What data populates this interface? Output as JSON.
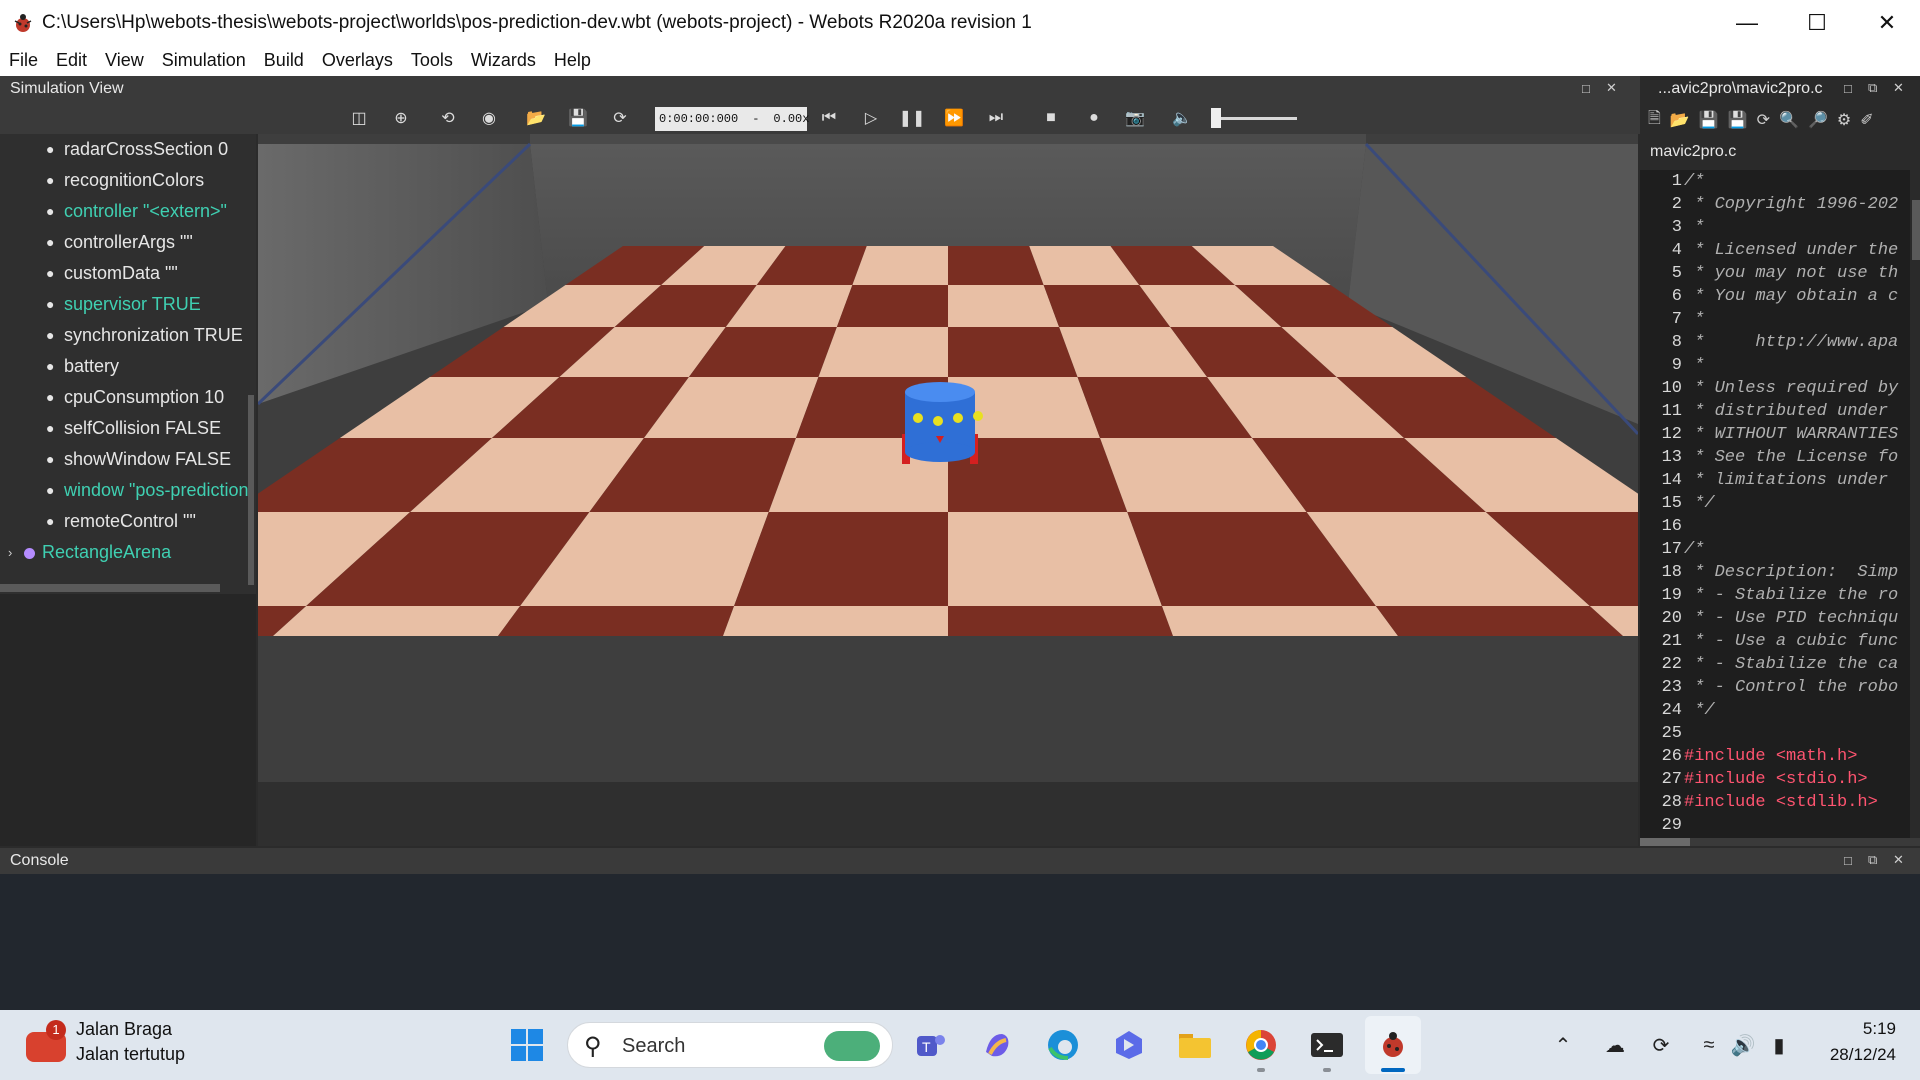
{
  "window": {
    "title": "C:\\Users\\Hp\\webots-thesis\\webots-project\\worlds\\pos-prediction-dev.wbt (webots-project) - Webots R2020a revision 1"
  },
  "menu": [
    "File",
    "Edit",
    "View",
    "Simulation",
    "Build",
    "Overlays",
    "Tools",
    "Wizards",
    "Help"
  ],
  "simulation_view": {
    "title": "Simulation View",
    "time": "0:00:00:000",
    "separator": "-",
    "speed": "0.00x",
    "sound_volume": 0.05
  },
  "scene_tree": {
    "fields": [
      {
        "label": "radarCrossSection 0",
        "highlight": false
      },
      {
        "label": "recognitionColors",
        "highlight": false
      },
      {
        "label": "controller \"<extern>\"",
        "highlight": true
      },
      {
        "label": "controllerArgs \"\"",
        "highlight": false
      },
      {
        "label": "customData \"\"",
        "highlight": false
      },
      {
        "label": "supervisor TRUE",
        "highlight": true
      },
      {
        "label": "synchronization TRUE",
        "highlight": false
      },
      {
        "label": "battery",
        "highlight": false
      },
      {
        "label": "cpuConsumption 10",
        "highlight": false
      },
      {
        "label": "selfCollision FALSE",
        "highlight": false
      },
      {
        "label": "showWindow FALSE",
        "highlight": false
      },
      {
        "label": "window \"pos-prediction",
        "highlight": true
      },
      {
        "label": "remoteControl \"\"",
        "highlight": false
      }
    ],
    "node": "RectangleArena"
  },
  "editor": {
    "title": "...avic2pro\\mavic2pro.c",
    "tab": "mavic2pro.c",
    "lines": [
      {
        "n": "1",
        "t": "/*"
      },
      {
        "n": "2",
        "t": " * Copyright 1996-202"
      },
      {
        "n": "3",
        "t": " *"
      },
      {
        "n": "4",
        "t": " * Licensed under the"
      },
      {
        "n": "5",
        "t": " * you may not use th"
      },
      {
        "n": "6",
        "t": " * You may obtain a c"
      },
      {
        "n": "7",
        "t": " *"
      },
      {
        "n": "8",
        "t": " *     http://www.apa"
      },
      {
        "n": "9",
        "t": " *"
      },
      {
        "n": "10",
        "t": " * Unless required by"
      },
      {
        "n": "11",
        "t": " * distributed under"
      },
      {
        "n": "12",
        "t": " * WITHOUT WARRANTIES"
      },
      {
        "n": "13",
        "t": " * See the License fo"
      },
      {
        "n": "14",
        "t": " * limitations under"
      },
      {
        "n": "15",
        "t": " */"
      },
      {
        "n": "16",
        "t": ""
      },
      {
        "n": "17",
        "t": "/*"
      },
      {
        "n": "18",
        "t": " * Description:  Simp"
      },
      {
        "n": "19",
        "t": " * - Stabilize the ro"
      },
      {
        "n": "20",
        "t": " * - Use PID techniqu"
      },
      {
        "n": "21",
        "t": " * - Use a cubic func"
      },
      {
        "n": "22",
        "t": " * - Stabilize the ca"
      },
      {
        "n": "23",
        "t": " * - Control the robo"
      },
      {
        "n": "24",
        "t": " */"
      },
      {
        "n": "25",
        "t": ""
      },
      {
        "n": "26",
        "t": "#include <math.h>"
      },
      {
        "n": "27",
        "t": "#include <stdio.h>"
      },
      {
        "n": "28",
        "t": "#include <stdlib.h>"
      },
      {
        "n": "29",
        "t": ""
      }
    ]
  },
  "console": {
    "title": "Console"
  },
  "taskbar": {
    "weather_title": "Jalan Braga",
    "weather_sub": "Jalan tertutup",
    "weather_badge": "1",
    "search_label": "Search",
    "time": "5:19",
    "date": "28/12/24"
  },
  "colors": {
    "highlight_field": "#3fd0b2",
    "include": "#ff5470",
    "floor_dark": "#7a2e22",
    "floor_light": "#e8bfa5",
    "robot_blue": "#2f6fd6"
  }
}
